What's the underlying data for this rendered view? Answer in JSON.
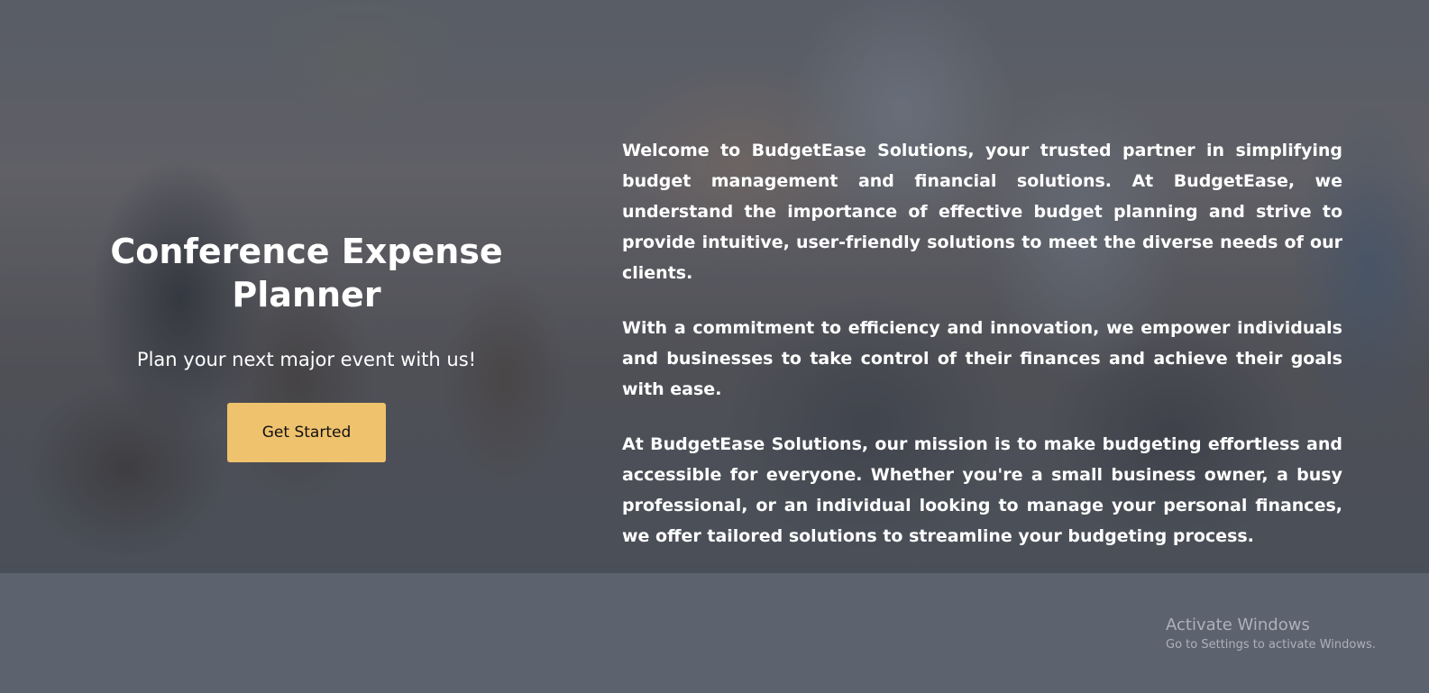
{
  "hero": {
    "title": "Conference Expense Planner",
    "subtitle": "Plan your next major event with us!",
    "cta_label": "Get Started"
  },
  "about": {
    "paragraphs": [
      "Welcome to BudgetEase Solutions, your trusted partner in simplifying budget management and financial solutions. At BudgetEase, we understand the importance of effective budget planning and strive to provide intuitive, user-friendly solutions to meet the diverse needs of our clients.",
      "With a commitment to efficiency and innovation, we empower individuals and businesses to take control of their finances and achieve their goals with ease.",
      "At BudgetEase Solutions, our mission is to make budgeting effortless and accessible for everyone. Whether you're a small business owner, a busy professional, or an individual looking to manage your personal finances, we offer tailored solutions to streamline your budgeting process."
    ]
  },
  "watermark": {
    "title": "Activate Windows",
    "subtitle": "Go to Settings to activate Windows."
  },
  "colors": {
    "button_bg": "#efc26d",
    "text": "#ffffff",
    "overlay": "#5c626e"
  }
}
